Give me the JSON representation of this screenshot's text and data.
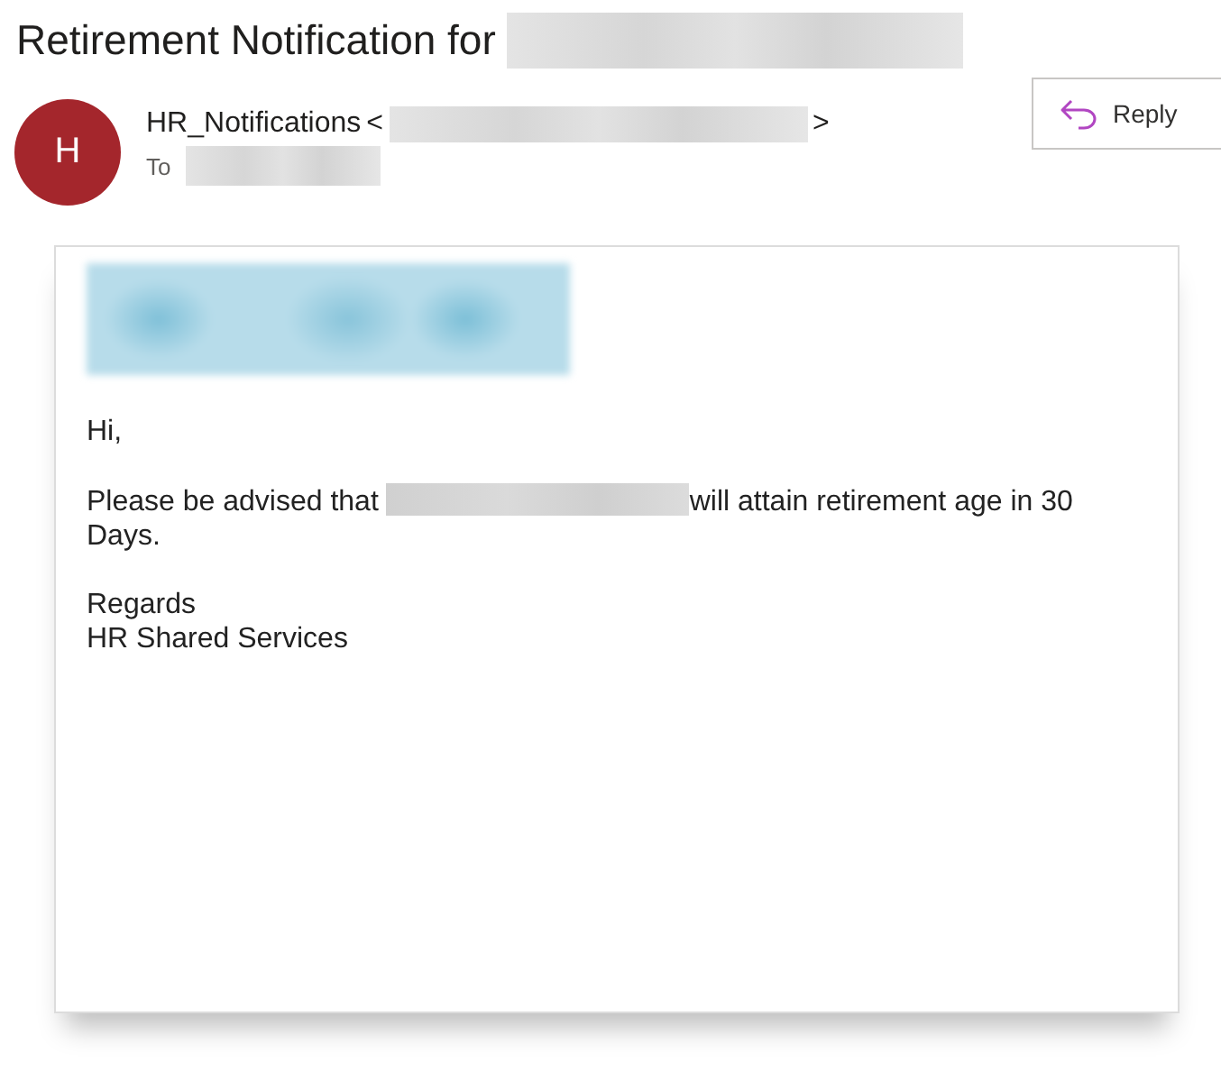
{
  "subject": "Retirement Notification for",
  "sender": {
    "initial": "H",
    "color": "#a4262c",
    "name": "HR_Notifications",
    "open_bracket": "<",
    "close_bracket": ">"
  },
  "recipient_label": "To",
  "reply_button": {
    "label": "Reply"
  },
  "body": {
    "greeting": "Hi,",
    "sentence_before": "Please be advised that",
    "sentence_after": "will attain retirement age in 30 Days.",
    "closing": "Regards",
    "signature": "HR Shared Services"
  }
}
